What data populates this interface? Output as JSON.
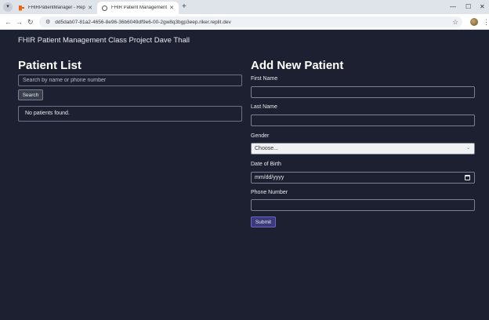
{
  "browser": {
    "tabs": [
      {
        "title": "FHIRPatientManager - Replit",
        "active": false,
        "icon": "replit-icon"
      },
      {
        "title": "FHIR Patient Management",
        "active": true,
        "icon": "globe-icon"
      }
    ],
    "url": "dd5dab07-81a2-4656-8e96-36b6049df9e6-00-2gw8q3bgp3eep.riker.replit.dev"
  },
  "app": {
    "brand": "FHIR Patient Management Class Project Dave Thall"
  },
  "patient_list": {
    "heading": "Patient List",
    "search_placeholder": "Search by name or phone number",
    "search_button": "Search",
    "empty_message": "No patients found."
  },
  "add_patient": {
    "heading": "Add New Patient",
    "first_name_label": "First Name",
    "last_name_label": "Last Name",
    "gender_label": "Gender",
    "gender_selected": "Choose...",
    "dob_label": "Date of Birth",
    "dob_placeholder": "mm/dd/yyyy",
    "phone_label": "Phone Number",
    "submit_button": "Submit"
  },
  "colors": {
    "background": "#1d2030",
    "submit": "#3d3a7a"
  }
}
